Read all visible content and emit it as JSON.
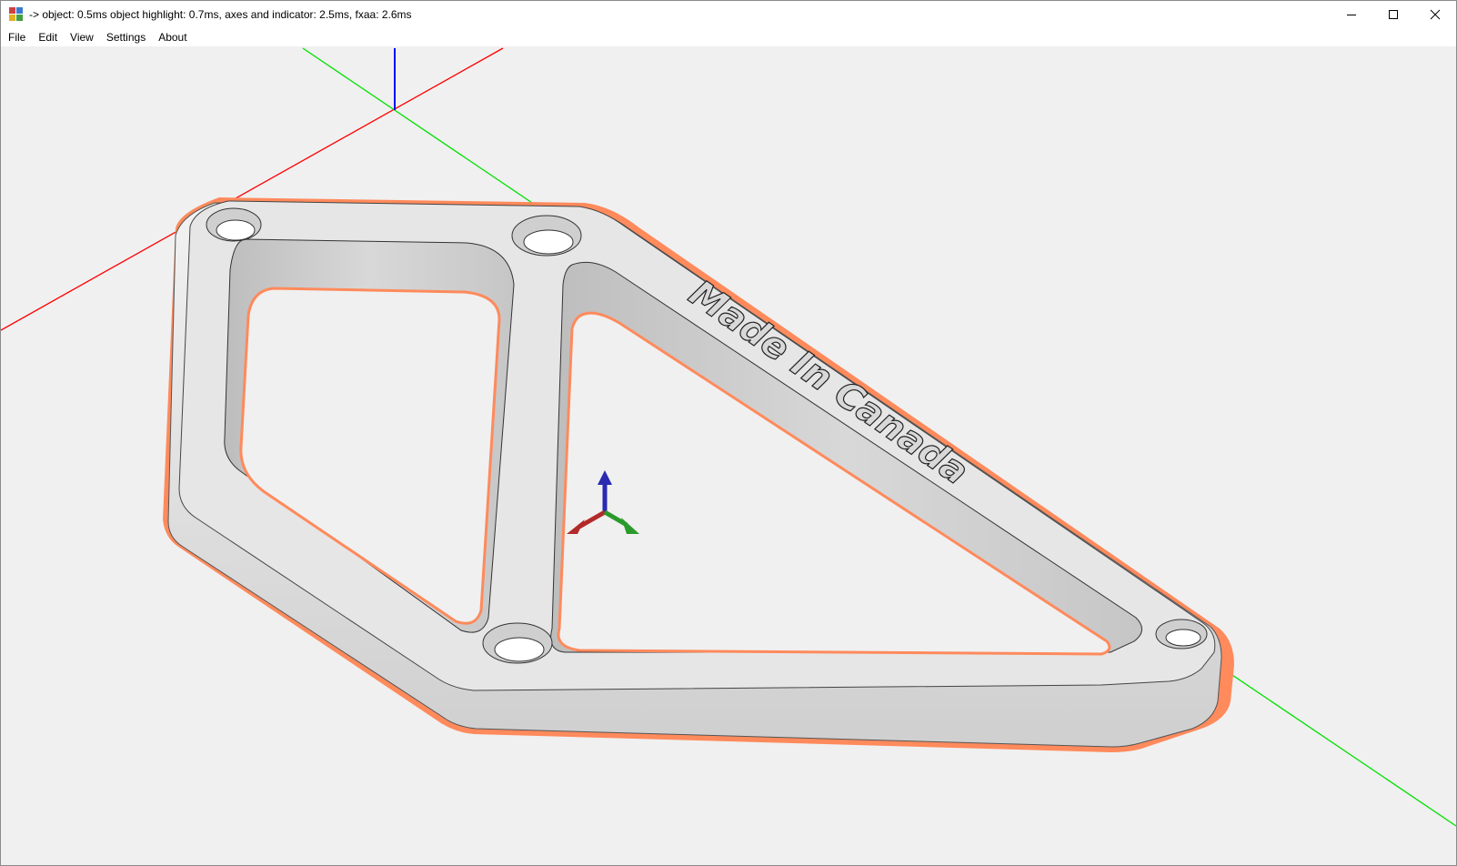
{
  "window": {
    "title": "-> object: 0.5ms object highlight: 0.7ms, axes and indicator: 2.5ms, fxaa: 2.6ms",
    "icon": "app-window-icon",
    "controls": {
      "minimize": "minimize-icon",
      "maximize": "maximize-icon",
      "close": "close-icon"
    }
  },
  "menu": {
    "items": [
      {
        "label": "File"
      },
      {
        "label": "Edit"
      },
      {
        "label": "View"
      },
      {
        "label": "Settings"
      },
      {
        "label": "About"
      }
    ]
  },
  "viewport": {
    "background": "#f0f0f0",
    "model": {
      "engraving": "Made In Canada",
      "body_color": "#dcdcdc",
      "highlight_color": "#ff8a5c",
      "hole_count": 4
    },
    "axes": {
      "x_color": "#ff0000",
      "y_color": "#00e000",
      "z_color": "#0000ff"
    },
    "indicator": {
      "x_color": "#b22a2a",
      "y_color": "#2a9a2a",
      "z_color": "#2a2ab2"
    }
  }
}
